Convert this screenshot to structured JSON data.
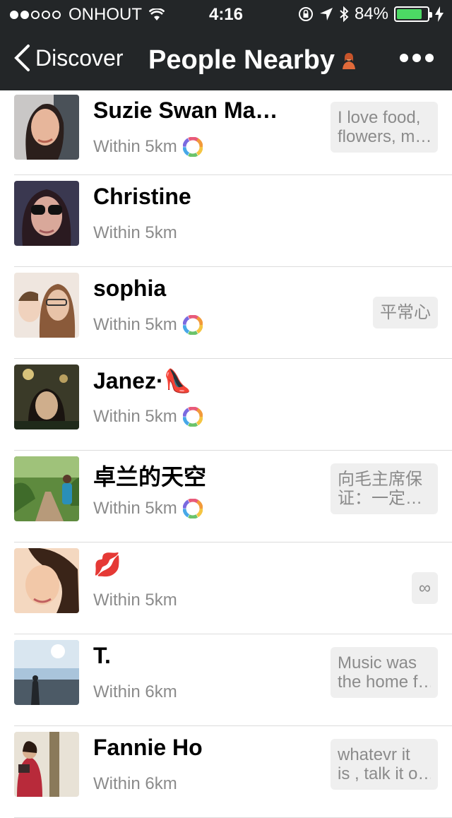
{
  "status_bar": {
    "carrier": "ONHOUT",
    "time": "4:16",
    "battery": "84%",
    "battery_fraction": 0.84,
    "signal_bars_filled": 2,
    "signal_bars_total": 5
  },
  "nav": {
    "back_label": "Discover",
    "title": "People Nearby"
  },
  "colors": {
    "nav_bg": "#232628",
    "battery_fill": "#4cd964",
    "distance_text": "#8b8b8b"
  },
  "people": [
    {
      "name": "Suzie Swan Ma…",
      "distance": "Within 5km",
      "moments": true,
      "bubble": [
        "I love food,",
        "flowers, m…"
      ]
    },
    {
      "name": "Christine",
      "distance": "Within 5km",
      "moments": false,
      "bubble": []
    },
    {
      "name": "sophia",
      "distance": "Within 5km",
      "moments": true,
      "bubble": [
        "平常心"
      ]
    },
    {
      "name": "Janez·👠",
      "distance": "Within 5km",
      "moments": true,
      "bubble": []
    },
    {
      "name": "卓兰的天空",
      "distance": "Within 5km",
      "moments": true,
      "bubble": [
        "向毛主席保",
        "证：一定…"
      ]
    },
    {
      "name": "💋",
      "distance": "Within 5km",
      "moments": false,
      "bubble": [
        "∞"
      ]
    },
    {
      "name": "T.",
      "distance": "Within 6km",
      "moments": false,
      "bubble": [
        "Music was",
        "the home f…"
      ]
    },
    {
      "name": "Fannie  Ho",
      "distance": "Within 6km",
      "moments": false,
      "bubble": [
        "whatevr it",
        "is , talk it o…"
      ]
    }
  ]
}
